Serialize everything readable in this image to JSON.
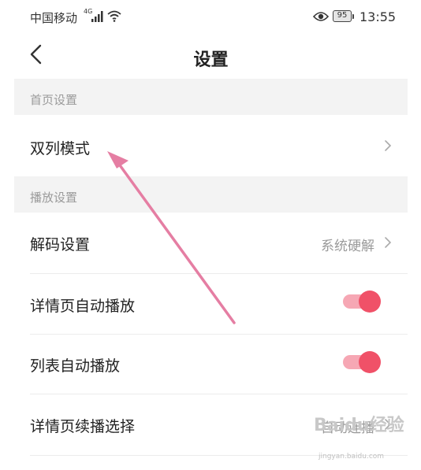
{
  "status_bar": {
    "carrier": "中国移动",
    "network": "4G",
    "battery": "95",
    "time": "13:55"
  },
  "nav": {
    "title": "设置"
  },
  "sections": [
    {
      "header": "首页设置",
      "rows": [
        {
          "label": "双列模式",
          "type": "link"
        }
      ]
    },
    {
      "header": "播放设置",
      "rows": [
        {
          "label": "解码设置",
          "type": "link",
          "value": "系统硬解"
        },
        {
          "label": "详情页自动播放",
          "type": "toggle",
          "on": true
        },
        {
          "label": "列表自动播放",
          "type": "toggle",
          "on": true
        },
        {
          "label": "详情页续播选择",
          "type": "link",
          "value": "自动连播"
        }
      ]
    }
  ],
  "colors": {
    "accent": "#f05168",
    "toggle_track": "#f6a7b4",
    "section_bg": "#f3f3f3",
    "annotation_arrow": "#e57ea3"
  },
  "watermark": {
    "text": "Baidu经验",
    "url": "jingyan.baidu.com"
  }
}
